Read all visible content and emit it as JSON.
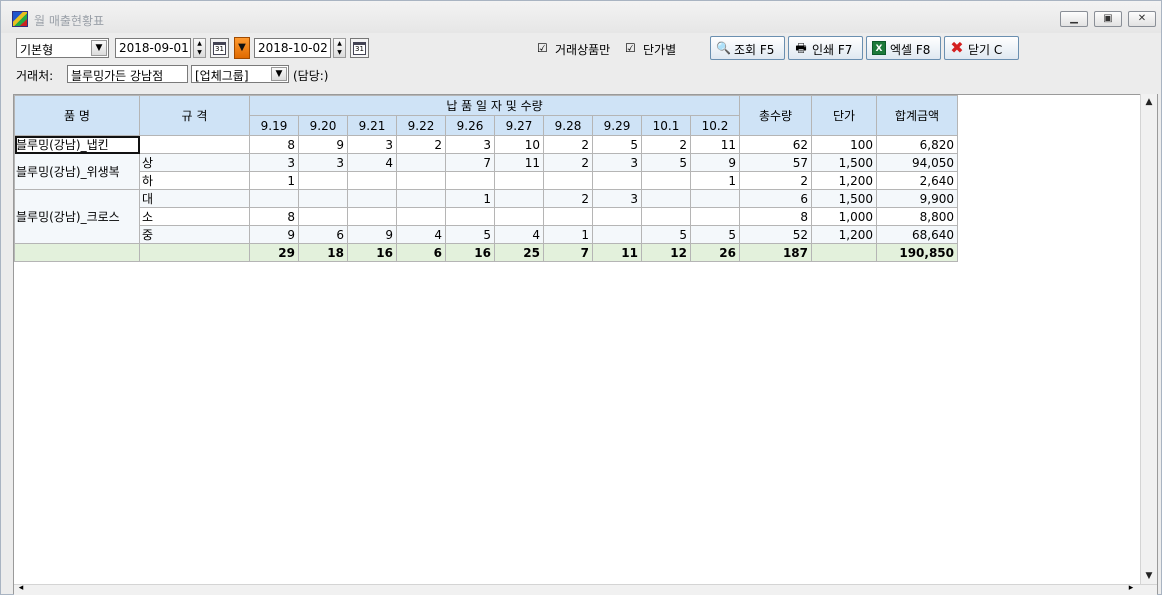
{
  "window": {
    "title": "월 매출현황표"
  },
  "toolbar": {
    "view_type": "기본형",
    "date_from": "2018-09-01",
    "date_to": "2018-10-02",
    "calendar_icon_text": "31",
    "check_trade_only": {
      "label": "거래상품만",
      "checked": "☑"
    },
    "check_by_price": {
      "label": "단가별",
      "checked": "☑"
    },
    "btn_search": "조회 F5",
    "btn_print": "인쇄 F7",
    "btn_excel": "엑셀 F8",
    "btn_close": "닫기 C",
    "customer_label": "거래처:",
    "customer_value": "블루밍가든 강남점",
    "group_value": "[업체그룹]",
    "manager_text": "(담당:)"
  },
  "grid": {
    "headers": {
      "item_name": "품  명",
      "spec": "규 격",
      "date_group": "납 품 일 자 및 수량",
      "dates": [
        "9.19",
        "9.20",
        "9.21",
        "9.22",
        "9.26",
        "9.27",
        "9.28",
        "9.29",
        "10.1",
        "10.2"
      ],
      "total_qty": "총수량",
      "unit_price": "단가",
      "total_amount": "합계금액"
    },
    "rows": [
      {
        "name": "블루밍(강남)_냅킨",
        "spec": "",
        "qty": [
          "8",
          "9",
          "3",
          "2",
          "3",
          "10",
          "2",
          "5",
          "2",
          "11"
        ],
        "total": "62",
        "price": "100",
        "amount": "6,820"
      },
      {
        "name": "블루밍(강남)_위생복",
        "spec": "상",
        "qty": [
          "3",
          "3",
          "4",
          "",
          "7",
          "11",
          "2",
          "3",
          "5",
          "9"
        ],
        "total": "57",
        "price": "1,500",
        "amount": "94,050"
      },
      {
        "name": "",
        "spec": "하",
        "qty": [
          "1",
          "",
          "",
          "",
          "",
          "",
          "",
          "",
          "",
          "1"
        ],
        "total": "2",
        "price": "1,200",
        "amount": "2,640"
      },
      {
        "name": "블루밍(강남)_크로스",
        "spec": "대",
        "qty": [
          "",
          "",
          "",
          "",
          "1",
          "",
          "2",
          "3",
          "",
          ""
        ],
        "total": "6",
        "price": "1,500",
        "amount": "9,900"
      },
      {
        "name": "",
        "spec": "소",
        "qty": [
          "8",
          "",
          "",
          "",
          "",
          "",
          "",
          "",
          "",
          ""
        ],
        "total": "8",
        "price": "1,000",
        "amount": "8,800"
      },
      {
        "name": "",
        "spec": "중",
        "qty": [
          "9",
          "6",
          "9",
          "4",
          "5",
          "4",
          "1",
          "",
          "5",
          "5"
        ],
        "total": "52",
        "price": "1,200",
        "amount": "68,640"
      }
    ],
    "totals": {
      "qty": [
        "29",
        "18",
        "16",
        "6",
        "16",
        "25",
        "7",
        "11",
        "12",
        "26"
      ],
      "total": "187",
      "amount": "190,850"
    }
  }
}
